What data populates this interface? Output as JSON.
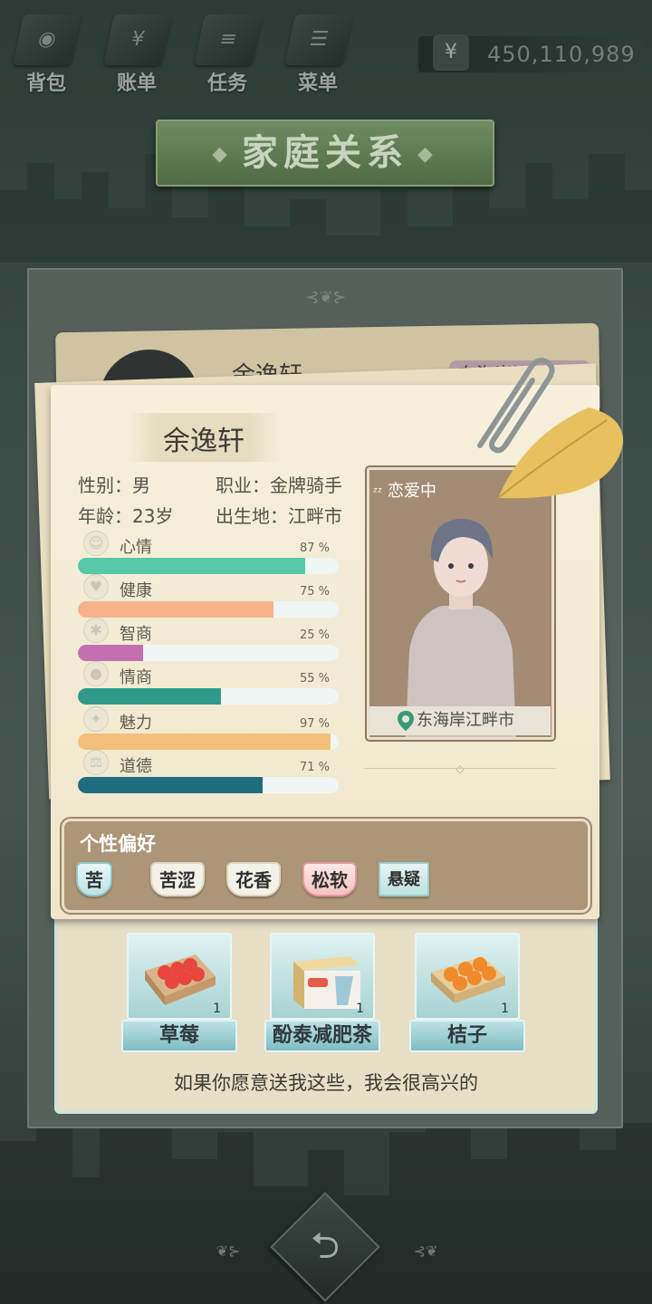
{
  "nav": {
    "items": [
      {
        "label": "背包",
        "icon": "backpack-icon"
      },
      {
        "label": "账单",
        "icon": "bill-icon"
      },
      {
        "label": "任务",
        "icon": "task-icon"
      },
      {
        "label": "菜单",
        "icon": "menu-icon"
      }
    ],
    "money": {
      "symbol": "¥",
      "value": "450,110,989"
    }
  },
  "title": "家庭关系",
  "back_card": {
    "name": "余逸轩",
    "location": "东海岸江畔市"
  },
  "profile": {
    "name": "余逸轩",
    "gender_label": "性别：男",
    "job_label": "职业：金牌骑手",
    "age_label": "年龄：23岁",
    "birthplace_label": "出生地：江畔市",
    "status": "恋爱中",
    "location": "东海岸江畔市"
  },
  "stats": [
    {
      "name": "心情",
      "pct_text": "87 %",
      "value": 87,
      "color": "#57c8a8"
    },
    {
      "name": "健康",
      "pct_text": "75 %",
      "value": 75,
      "color": "#f6b28a"
    },
    {
      "name": "智商",
      "pct_text": "25 %",
      "value": 25,
      "color": "#c46fb2"
    },
    {
      "name": "情商",
      "pct_text": "55 %",
      "value": 55,
      "color": "#2f9a8a"
    },
    {
      "name": "魅力",
      "pct_text": "97 %",
      "value": 97,
      "color": "#f2c07a"
    },
    {
      "name": "道德",
      "pct_text": "71 %",
      "value": 71,
      "color": "#1f6c7e"
    }
  ],
  "preferences": {
    "title": "个性偏好",
    "tags": [
      "苦",
      "苦涩",
      "花香",
      "松软",
      "悬疑"
    ]
  },
  "gifts": {
    "items": [
      {
        "label": "草莓",
        "count": "1"
      },
      {
        "label": "酚泰减肥茶",
        "count": "1"
      },
      {
        "label": "桔子",
        "count": "1"
      }
    ],
    "message": "如果你愿意送我这些，我会很高兴的"
  }
}
